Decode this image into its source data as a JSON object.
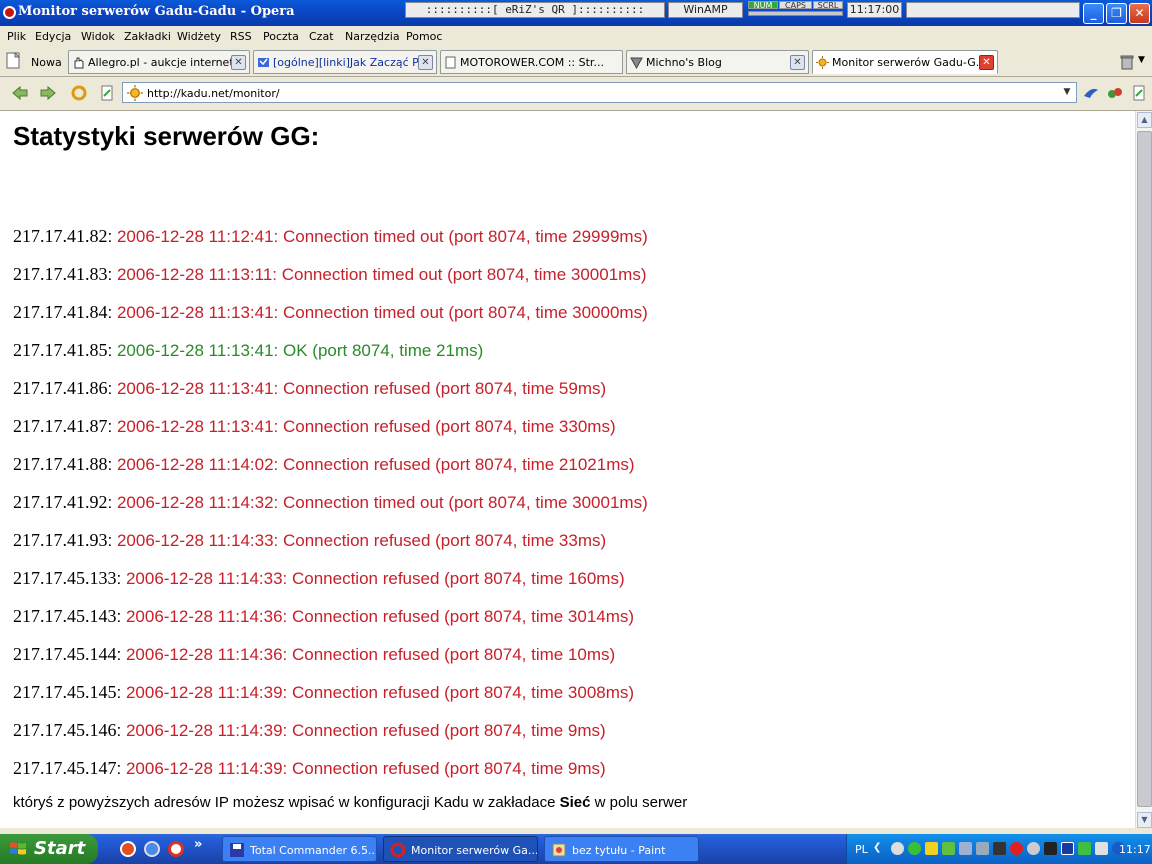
{
  "window": {
    "title": "Monitor serwerów Gadu-Gadu - Opera",
    "tray_qr": "::::::::::[ eRiZ's QR ]::::::::::",
    "winamp": "WinAMP",
    "locks": [
      "NUM",
      "CAPS",
      "SCRL"
    ],
    "clock": "11:17:00",
    "controls": [
      "_",
      "❐",
      "✕"
    ]
  },
  "menu": [
    "Plik",
    "Edycja",
    "Widok",
    "Zakładki",
    "Widżety",
    "RSS",
    "Poczta",
    "Czat",
    "Narzędzia",
    "Pomoc"
  ],
  "tabs": {
    "new_tab": "Nowa",
    "items": [
      {
        "label": "Allegro.pl - aukcje internet...",
        "icon": "hand-icon"
      },
      {
        "label": "[ogólne][linki]Jak Zacząć P...",
        "icon": "forum-icon"
      },
      {
        "label": "MOTOROWER.COM :: Str...",
        "icon": "page-icon"
      },
      {
        "label": "Michno's Blog",
        "icon": "blog-icon"
      },
      {
        "label": "Monitor serwerów Gadu-G...",
        "icon": "sun-icon",
        "active": true
      }
    ]
  },
  "address": {
    "url": "http://kadu.net/monitor/"
  },
  "page": {
    "heading": "Statystyki serwerów GG:",
    "servers": [
      {
        "ip": "217.17.41.82",
        "status": "2006-12-28 11:12:41: Connection timed out (port 8074, time 29999ms)",
        "ok": false
      },
      {
        "ip": "217.17.41.83",
        "status": "2006-12-28 11:13:11: Connection timed out (port 8074, time 30001ms)",
        "ok": false
      },
      {
        "ip": "217.17.41.84",
        "status": "2006-12-28 11:13:41: Connection timed out (port 8074, time 30000ms)",
        "ok": false
      },
      {
        "ip": "217.17.41.85",
        "status": "2006-12-28 11:13:41: OK (port 8074, time 21ms)",
        "ok": true
      },
      {
        "ip": "217.17.41.86",
        "status": "2006-12-28 11:13:41: Connection refused (port 8074, time 59ms)",
        "ok": false
      },
      {
        "ip": "217.17.41.87",
        "status": "2006-12-28 11:13:41: Connection refused (port 8074, time 330ms)",
        "ok": false
      },
      {
        "ip": "217.17.41.88",
        "status": "2006-12-28 11:14:02: Connection refused (port 8074, time 21021ms)",
        "ok": false
      },
      {
        "ip": "217.17.41.92",
        "status": "2006-12-28 11:14:32: Connection timed out (port 8074, time 30001ms)",
        "ok": false
      },
      {
        "ip": "217.17.41.93",
        "status": "2006-12-28 11:14:33: Connection refused (port 8074, time 33ms)",
        "ok": false
      },
      {
        "ip": "217.17.45.133",
        "status": "2006-12-28 11:14:33: Connection refused (port 8074, time 160ms)",
        "ok": false
      },
      {
        "ip": "217.17.45.143",
        "status": "2006-12-28 11:14:36: Connection refused (port 8074, time 3014ms)",
        "ok": false
      },
      {
        "ip": "217.17.45.144",
        "status": "2006-12-28 11:14:36: Connection refused (port 8074, time 10ms)",
        "ok": false
      },
      {
        "ip": "217.17.45.145",
        "status": "2006-12-28 11:14:39: Connection refused (port 8074, time 3008ms)",
        "ok": false
      },
      {
        "ip": "217.17.45.146",
        "status": "2006-12-28 11:14:39: Connection refused (port 8074, time 9ms)",
        "ok": false
      },
      {
        "ip": "217.17.45.147",
        "status": "2006-12-28 11:14:39: Connection refused (port 8074, time 9ms)",
        "ok": false
      }
    ],
    "separator": ": ",
    "footer_before": "któryś z powyższych adresów IP możesz wpisać w konfiguracji Kadu w zakładace ",
    "footer_bold": "Sieć",
    "footer_after": " w polu serwer"
  },
  "colors": {
    "error": "#c8202a",
    "ok": "#2a8a2a"
  },
  "taskbar": {
    "start": "Start",
    "tasks": [
      {
        "label": "Total Commander 6.5...",
        "icon": "floppy-icon"
      },
      {
        "label": "Monitor serwerów Ga...",
        "icon": "opera-icon",
        "active": true
      },
      {
        "label": "bez tytułu - Paint",
        "icon": "paint-icon"
      }
    ],
    "overflow": "»",
    "lang": "PL",
    "clock": "11:17"
  }
}
